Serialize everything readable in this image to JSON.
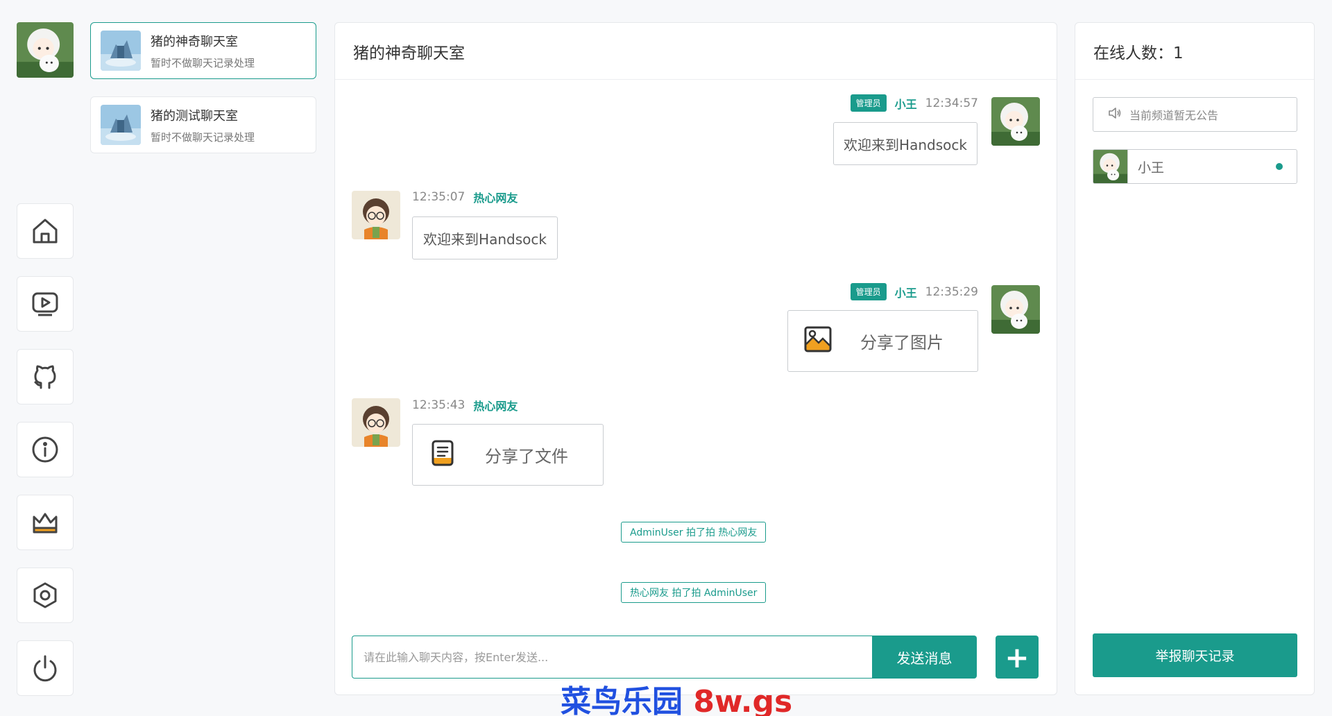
{
  "rooms": [
    {
      "name": "猪的神奇聊天室",
      "sub": "暂时不做聊天记录处理"
    },
    {
      "name": "猪的测试聊天室",
      "sub": "暂时不做聊天记录处理"
    }
  ],
  "nav": [
    "home-icon",
    "video-icon",
    "github-icon",
    "info-icon",
    "crown-icon",
    "settings-icon",
    "power-icon"
  ],
  "chat": {
    "title": "猪的神奇聊天室",
    "messages": [
      {
        "badge": "管理员",
        "user": "小王",
        "time": "12:34:57",
        "text": "欢迎来到Handsock"
      },
      {
        "time": "12:35:07",
        "user": "热心网友",
        "text": "欢迎来到Handsock"
      },
      {
        "badge": "管理员",
        "user": "小王",
        "time": "12:35:29",
        "text": "分享了图片"
      },
      {
        "time": "12:35:43",
        "user": "热心网友",
        "text": "分享了文件"
      }
    ],
    "system": [
      "AdminUser 拍了拍 热心网友",
      "热心网友 拍了拍 AdminUser"
    ],
    "input_placeholder": "请在此输入聊天内容，按Enter发送...",
    "send_label": "发送消息",
    "plus_label": "+"
  },
  "right": {
    "online_title": "在线人数：1",
    "notice": "当前频道暂无公告",
    "members": [
      {
        "name": "小王"
      }
    ],
    "report_label": "举报聊天记录"
  },
  "watermark": {
    "part1": "菜鸟乐园",
    "part2": "8w.gs"
  },
  "colors": {
    "accent": "#1a9b8c",
    "background": "#f7f8fa"
  }
}
